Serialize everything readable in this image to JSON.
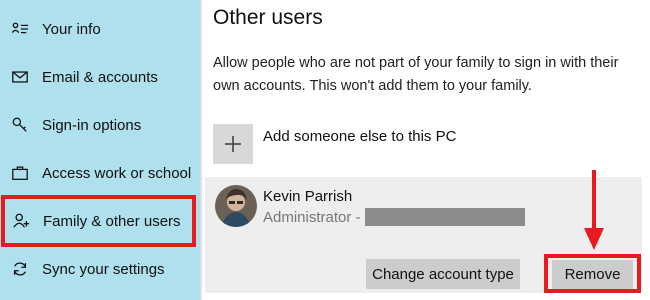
{
  "sidebar": {
    "items": [
      {
        "label": "Your info",
        "icon": "person-card-icon"
      },
      {
        "label": "Email & accounts",
        "icon": "envelope-icon"
      },
      {
        "label": "Sign-in options",
        "icon": "key-icon"
      },
      {
        "label": "Access work or school",
        "icon": "briefcase-icon"
      },
      {
        "label": "Family & other users",
        "icon": "person-add-icon",
        "active": true
      },
      {
        "label": "Sync your settings",
        "icon": "sync-icon"
      }
    ]
  },
  "main": {
    "title": "Other users",
    "description": "Allow people who are not part of your family to sign in with their own accounts. This won't add them to your family.",
    "add_label": "Add someone else to this PC",
    "user": {
      "name": "Kevin Parrish",
      "role": "Administrator -"
    },
    "buttons": {
      "change": "Change account type",
      "remove": "Remove"
    }
  },
  "colors": {
    "sidebar_bg": "#aee0ee",
    "highlight": "#e8191f",
    "card_bg": "#eeeeee",
    "button_bg": "#cccccc"
  }
}
